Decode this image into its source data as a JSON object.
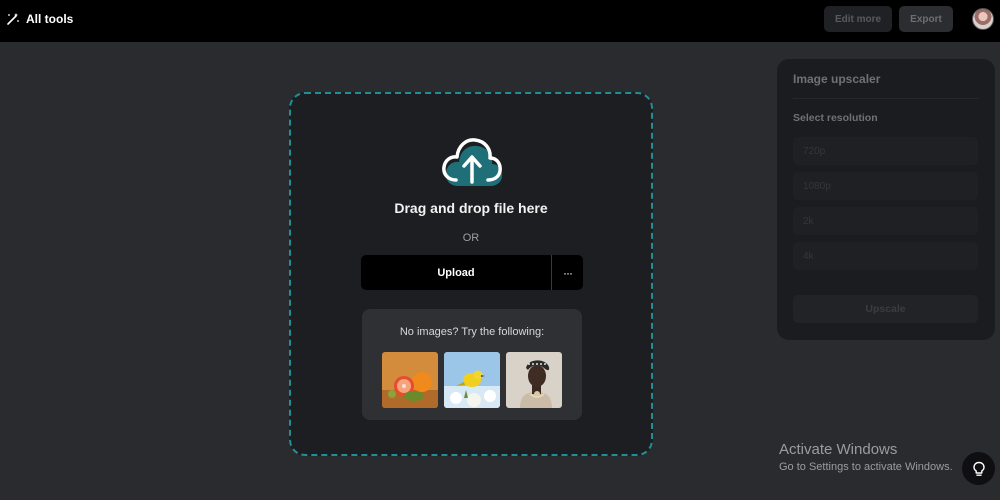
{
  "header": {
    "all_tools_label": "All tools",
    "all_tools_icon": "magic-wand-icon",
    "edit_more_label": "Edit more",
    "export_label": "Export",
    "avatar": "user-avatar"
  },
  "upload_area": {
    "icon": "cloud-upload-icon",
    "drag_text": "Drag and drop file here",
    "or_text": "OR",
    "upload_label": "Upload",
    "more_label": "···",
    "samples": {
      "title": "No images? Try the following:",
      "items": [
        "citrus-fruits-sample",
        "yellow-bird-sample",
        "woman-portrait-sample"
      ]
    }
  },
  "panel": {
    "heading": "Image upscaler",
    "select_label": "Select resolution",
    "resolutions": [
      "720p",
      "1080p",
      "2k",
      "4k"
    ],
    "upscale_label": "Upscale"
  },
  "watermark": {
    "title": "Activate Windows",
    "subtitle": "Go to Settings to activate Windows."
  },
  "help_icon": "lightbulb-icon",
  "colors": {
    "accent_border": "#1f8f95",
    "cloud_teal": "#1e6f78",
    "background": "#2a2b2f",
    "topbar": "#000000"
  }
}
